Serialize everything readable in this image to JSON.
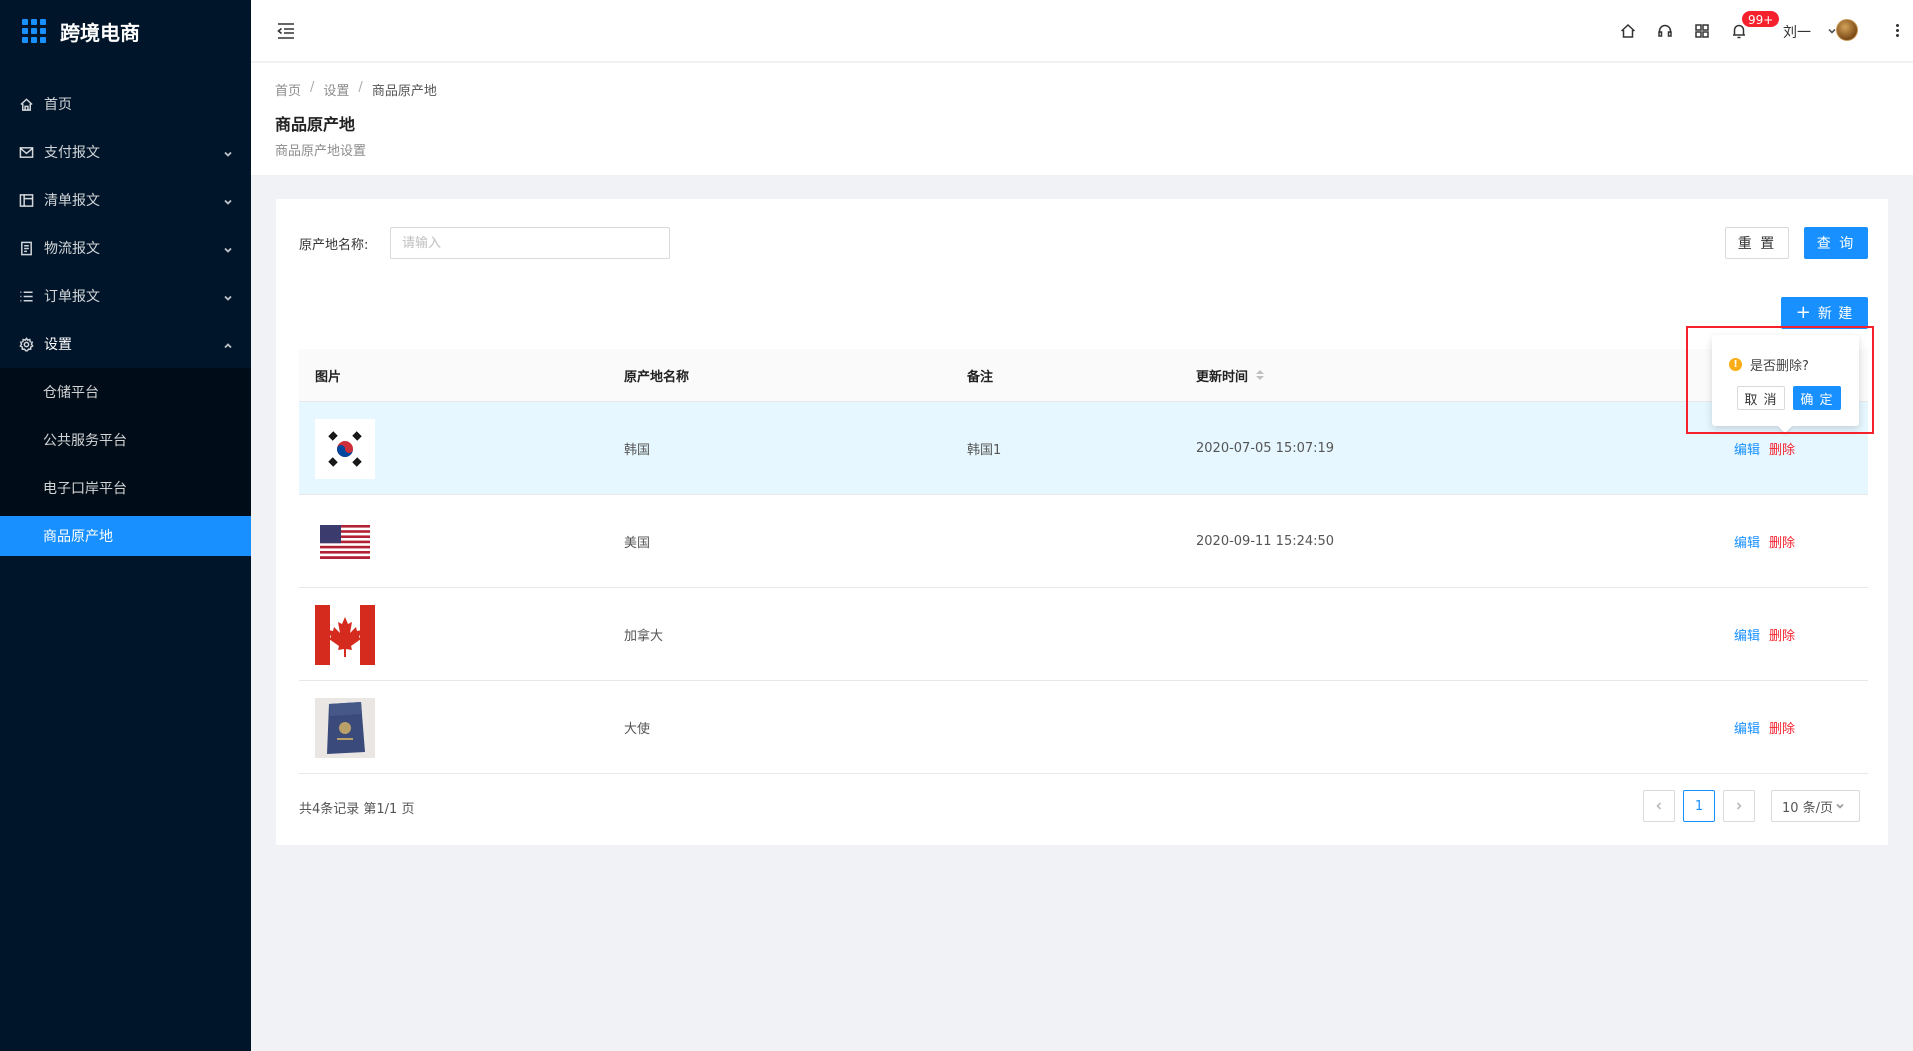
{
  "app": {
    "title": "跨境电商"
  },
  "sidebar": {
    "items": [
      {
        "label": "首页",
        "icon": "home-icon"
      },
      {
        "label": "支付报文",
        "icon": "mail-icon"
      },
      {
        "label": "清单报文",
        "icon": "layout-icon"
      },
      {
        "label": "物流报文",
        "icon": "file-icon"
      },
      {
        "label": "订单报文",
        "icon": "list-icon"
      },
      {
        "label": "设置",
        "icon": "gear-icon"
      }
    ],
    "settings_children": [
      {
        "label": "仓储平台"
      },
      {
        "label": "公共服务平台"
      },
      {
        "label": "电子口岸平台"
      },
      {
        "label": "商品原产地",
        "active": true
      }
    ]
  },
  "header": {
    "notification_badge": "99+",
    "user_name": "刘一"
  },
  "breadcrumb": [
    "首页",
    "设置",
    "商品原产地"
  ],
  "page": {
    "title": "商品原产地",
    "description": "商品原产地设置"
  },
  "search": {
    "label": "原产地名称:",
    "placeholder": "请输入",
    "value": "",
    "reset_label": "重 置",
    "query_label": "查 询",
    "new_label": "新 建"
  },
  "table": {
    "columns": [
      "图片",
      "原产地名称",
      "备注",
      "更新时间",
      ""
    ],
    "rows": [
      {
        "image": "flag-korea",
        "name": "韩国",
        "note": "韩国1",
        "updated": "2020-07-05 15:07:19",
        "edit": "编辑",
        "delete": "删除"
      },
      {
        "image": "flag-usa",
        "name": "美国",
        "note": "",
        "updated": "2020-09-11 15:24:50",
        "edit": "编辑",
        "delete": "删除"
      },
      {
        "image": "flag-canada",
        "name": "加拿大",
        "note": "",
        "updated": "",
        "edit": "编辑",
        "delete": "删除"
      },
      {
        "image": "passport-photo",
        "name": "大使",
        "note": "",
        "updated": "",
        "edit": "编辑",
        "delete": "删除"
      }
    ]
  },
  "pagination": {
    "summary": "共4条记录 第1/1 页",
    "current_page": "1",
    "page_size": "10 条/页"
  },
  "popconfirm": {
    "message": "是否删除?",
    "cancel_label": "取 消",
    "ok_label": "确 定"
  },
  "colors": {
    "sidebar_bg": "#001529",
    "primary": "#1890ff",
    "danger": "#f5222d",
    "row_highlight": "#e6f7ff",
    "warning": "#faad14"
  }
}
